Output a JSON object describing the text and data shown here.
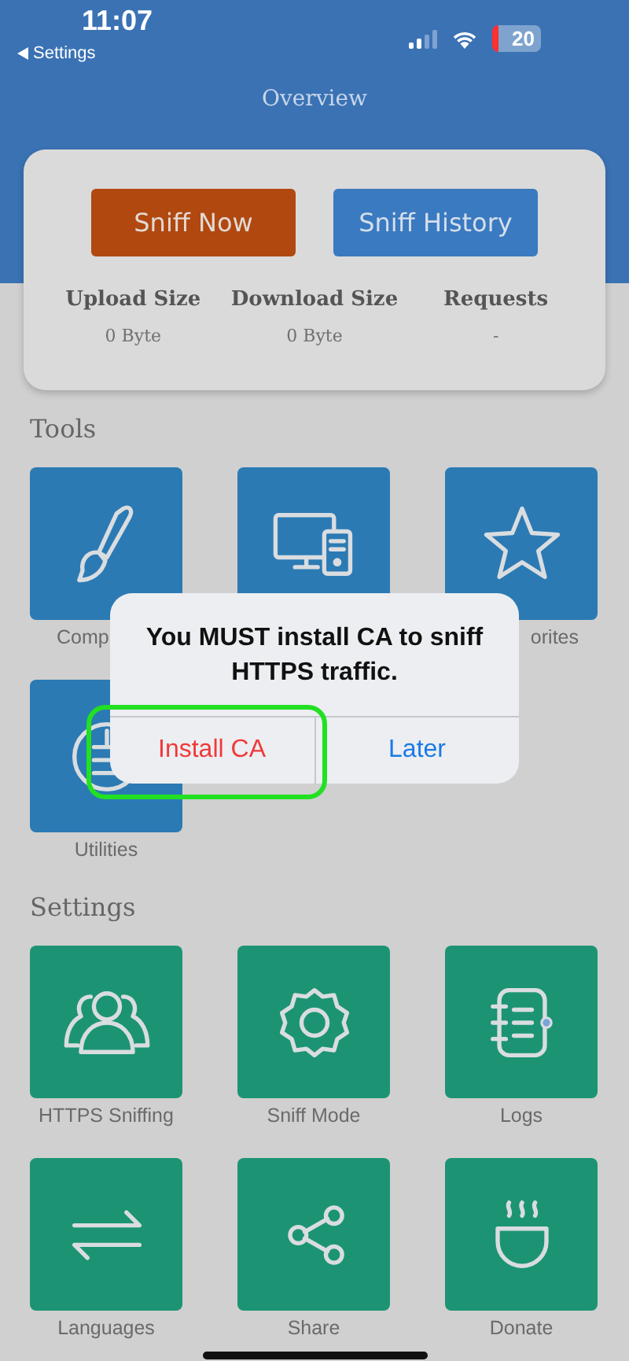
{
  "status_bar": {
    "time": "11:07",
    "back_label": "Settings",
    "battery": "20"
  },
  "header": {
    "title": "Overview"
  },
  "overview": {
    "buttons": [
      {
        "label": "Sniff Now",
        "kind": "primary"
      },
      {
        "label": "Sniff History",
        "kind": "secondary"
      }
    ],
    "stats": [
      {
        "label": "Upload Size",
        "value": "0 Byte"
      },
      {
        "label": "Download Size",
        "value": "0 Byte"
      },
      {
        "label": "Requests",
        "value": "-"
      }
    ]
  },
  "sections": [
    {
      "title": "Tools",
      "tiles": [
        {
          "kind": "tool",
          "label": "Comp"
        },
        {
          "kind": "tool"
        },
        {
          "kind": "tool",
          "label": "orites"
        },
        {
          "kind": "tool",
          "label": "Utilities"
        }
      ]
    },
    {
      "title": "Settings",
      "tiles": [
        {
          "kind": "setting",
          "label": "HTTPS Sniffing"
        },
        {
          "kind": "setting",
          "label": "Sniff Mode"
        },
        {
          "kind": "setting",
          "label": "Logs"
        },
        {
          "kind": "setting",
          "label": "Languages"
        },
        {
          "kind": "setting",
          "label": "Share"
        },
        {
          "kind": "setting",
          "label": "Donate"
        }
      ]
    }
  ],
  "dialog": {
    "message": "You MUST install CA to sniff HTTPS traffic.",
    "actions": [
      {
        "label": "Install CA",
        "kind": "destructive",
        "highlighted": true
      },
      {
        "label": "Later",
        "kind": "default",
        "highlighted": false
      }
    ]
  }
}
